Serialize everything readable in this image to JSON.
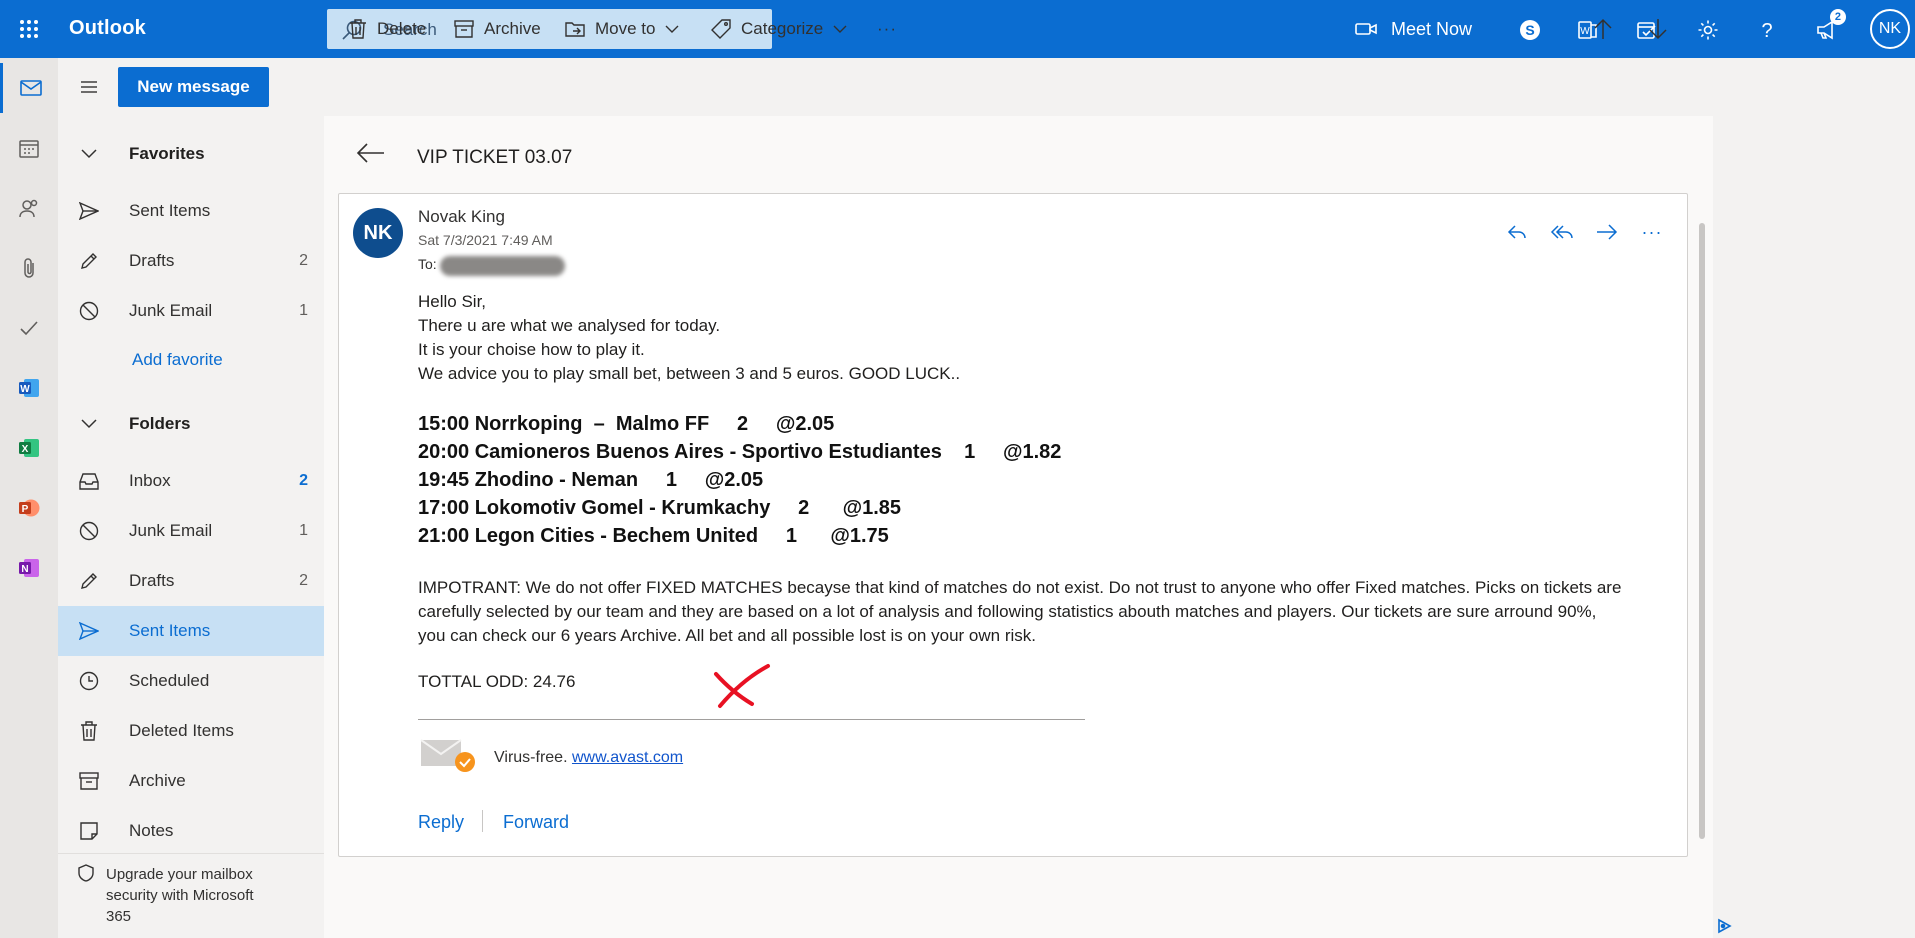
{
  "app": {
    "name": "Outlook"
  },
  "search": {
    "placeholder": "Search"
  },
  "header": {
    "meet_now": "Meet Now",
    "notification_count": "2",
    "user_initials": "NK"
  },
  "toolbar": {
    "new_message": "New message",
    "delete": "Delete",
    "archive": "Archive",
    "move_to": "Move to",
    "categorize": "Categorize",
    "more": "···"
  },
  "sidebar": {
    "favorites_header": "Favorites",
    "favorites": [
      {
        "label": "Sent Items",
        "count": ""
      },
      {
        "label": "Drafts",
        "count": "2"
      },
      {
        "label": "Junk Email",
        "count": "1"
      }
    ],
    "add_favorite": "Add favorite",
    "folders_header": "Folders",
    "folders": [
      {
        "label": "Inbox",
        "count": "2"
      },
      {
        "label": "Junk Email",
        "count": "1"
      },
      {
        "label": "Drafts",
        "count": "2"
      },
      {
        "label": "Sent Items",
        "count": ""
      },
      {
        "label": "Scheduled",
        "count": ""
      },
      {
        "label": "Deleted Items",
        "count": ""
      },
      {
        "label": "Archive",
        "count": ""
      },
      {
        "label": "Notes",
        "count": ""
      }
    ],
    "upgrade": "Upgrade your mailbox security with Microsoft 365"
  },
  "message": {
    "subject": "VIP TICKET 03.07",
    "sender_initials": "NK",
    "sender": "Novak King",
    "date": "Sat 7/3/2021 7:49 AM",
    "to_label": "To:",
    "greeting": "Hello Sir,",
    "lines": [
      "There u are what we analysed for today.",
      "It is your choise how to play it.",
      "We advice you to play small bet, between 3 and 5 euros. GOOD LUCK.."
    ],
    "picks": [
      "15:00 Norrkoping  –  Malmo FF     2     @2.05",
      "20:00 Camioneros Buenos Aires - Sportivo Estudiantes    1     @1.82",
      "19:45 Zhodino - Neman     1     @2.05",
      "17:00 Lokomotiv Gomel - Krumkachy     2      @1.85",
      "21:00 Legon Cities - Bechem United     1      @1.75"
    ],
    "important": "IMPOTRANT: We do not offer FIXED MATCHES becayse that kind of matches do not exist. Do not trust to anyone who offer Fixed matches. Picks on tickets are carefully selected by our team and they are based on a lot of analysis and following statistics abouth matches and players. Our tickets are sure arround 90%, you can check our 6 years Archive. All bet and all possible lost is on your own risk.",
    "total_odd": "TOTTAL ODD: 24.76",
    "virus_free": "Virus-free.",
    "avast_link": "www.avast.com",
    "reply": "Reply",
    "forward": "Forward"
  },
  "colors": {
    "brand": "#0b6dd1",
    "selected": "#c7e0f4",
    "avatar": "#0e4d8e",
    "red_mark": "#e81123"
  }
}
